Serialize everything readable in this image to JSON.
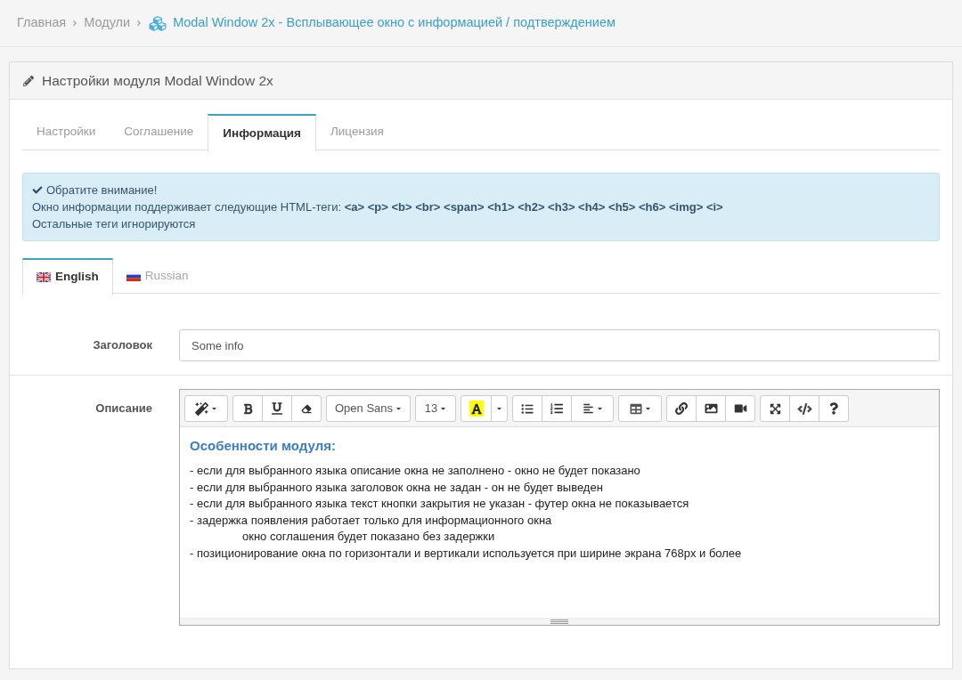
{
  "breadcrumb": [
    {
      "label": "Главная",
      "current": false
    },
    {
      "label": "Модули",
      "current": false
    },
    {
      "label": "Modal Window 2x - Всплывающее окно с информацией / подтверждением",
      "current": true
    }
  ],
  "panel": {
    "title": "Настройки модуля Modal Window 2x"
  },
  "tabs": [
    {
      "label": "Настройки",
      "selected": false
    },
    {
      "label": "Соглашение",
      "selected": false
    },
    {
      "label": "Информация",
      "selected": true
    },
    {
      "label": "Лицензия",
      "selected": false
    }
  ],
  "alert": {
    "heading": "Обратите внимание!",
    "lines": [
      "Окно информации поддерживает следующие HTML-теги: **<a> <p> <b> <br> <span> <h1> <h2> <h3> <h4> <h5> <h6> <img> <i>**",
      "Остальные теги игнорируются"
    ]
  },
  "language_tabs": [
    {
      "label": "English",
      "selected": true
    },
    {
      "label": "Russian",
      "selected": false
    }
  ],
  "fields": [
    {
      "kind": "input",
      "label": "Заголовок",
      "value": "Some info"
    },
    {
      "kind": "editor",
      "label": "Описание",
      "editor": {
        "toolbar": {
          "font_family": "Open Sans",
          "font_size": "13"
        },
        "content": {
          "heading": "Особенности модуля:",
          "items": [
            {
              "text": "- если для выбранного языка описание окна не заполнено - окно не будет показано"
            },
            {
              "text": "- если для выбранного языка заголовок окна не задан - он не будет выведен"
            },
            {
              "text": "- если для выбранного языка текст кнопки закрытия не указан - футер окна не показывается"
            },
            {
              "text": "- задержка появления работает только для информационного окна",
              "children": [
                {
                  "text": "окно соглашения будет показано без задержки"
                }
              ]
            },
            {
              "text": "- позиционирование окна по горизонтали и вертикали используется при ширине экрана 768px и более"
            }
          ]
        }
      }
    }
  ]
}
